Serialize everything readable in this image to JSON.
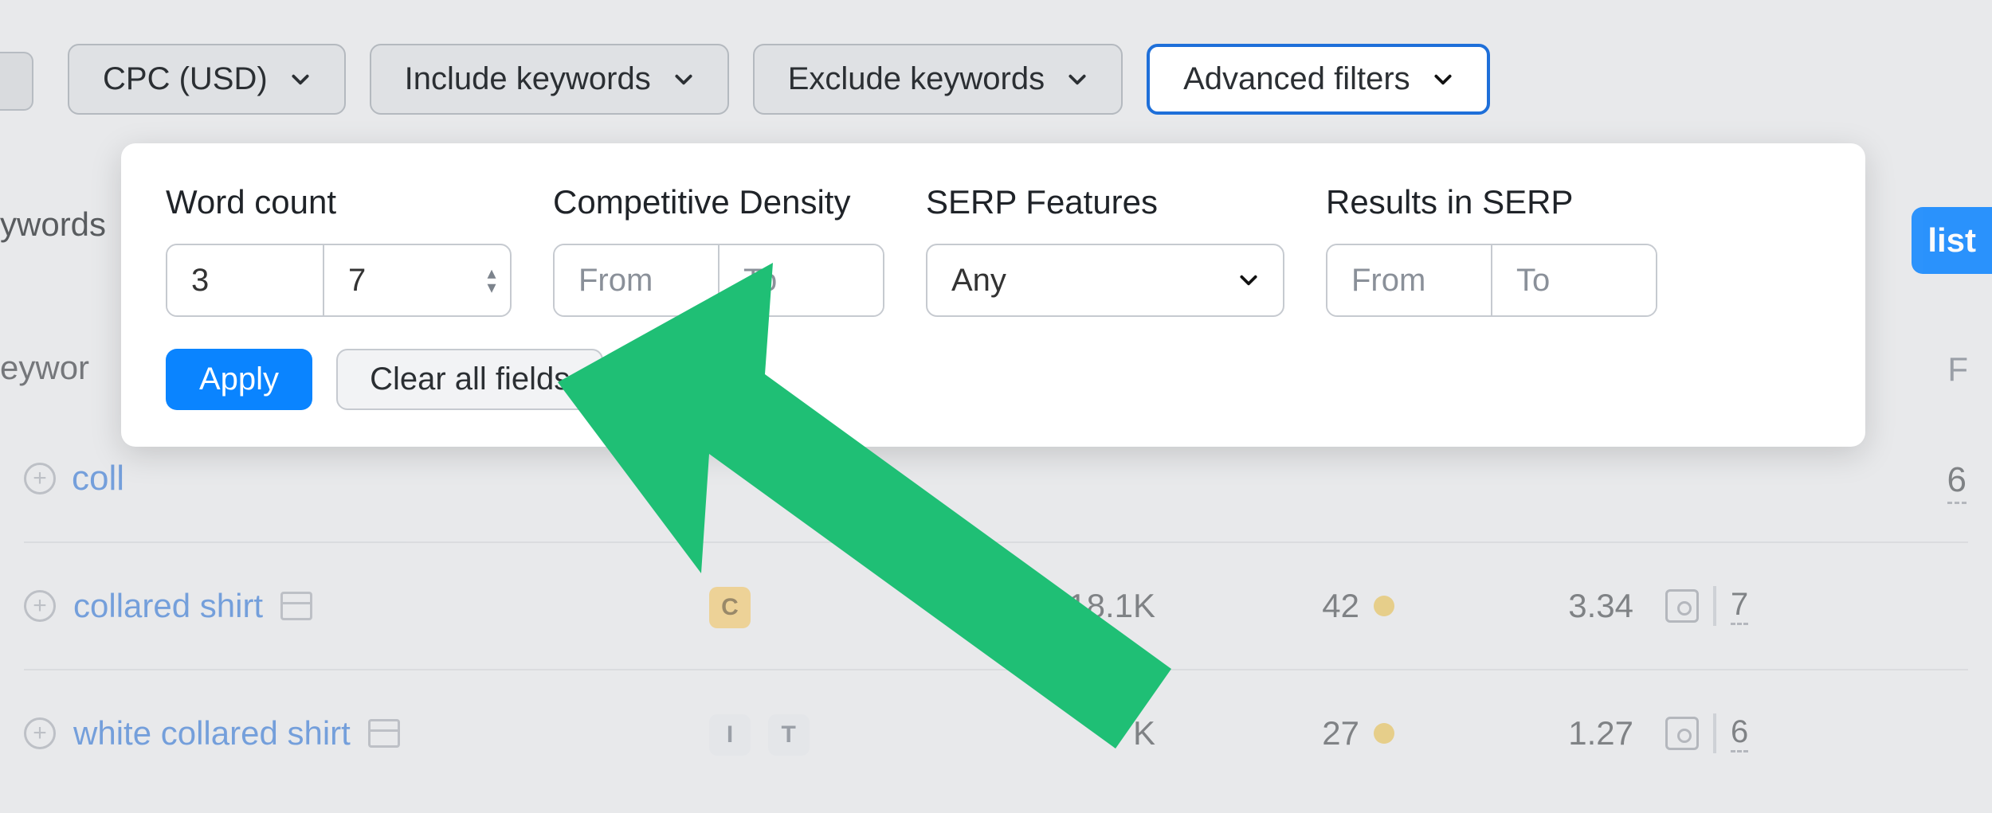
{
  "filters": {
    "cpc_label": "CPC (USD)",
    "include_label": "Include keywords",
    "exclude_label": "Exclude keywords",
    "advanced_label": "Advanced filters"
  },
  "fragments": {
    "left1": "ywords",
    "left2": "eywor",
    "right_col": "F",
    "coll": "coll",
    "six": "6",
    "list_chip": "list"
  },
  "popover": {
    "word_count": {
      "label": "Word count",
      "from": "3",
      "to": "7"
    },
    "competitive_density": {
      "label": "Competitive Density",
      "from_ph": "From",
      "to_ph": "To"
    },
    "serp_features": {
      "label": "SERP Features",
      "value": "Any"
    },
    "results_serp": {
      "label": "Results in SERP",
      "from_ph": "From",
      "to_ph": "To"
    },
    "apply": "Apply",
    "clear": "Clear all fields"
  },
  "rows": [
    {
      "keyword": "collared shirt",
      "intent_badges": [
        "C"
      ],
      "volume": "18.1K",
      "kd": "42",
      "cpc": "3.34",
      "sf": "7"
    },
    {
      "keyword": "white collared shirt",
      "intent_badges": [
        "I",
        "T"
      ],
      "volume": "K",
      "kd": "27",
      "cpc": "1.27",
      "sf": "6"
    }
  ]
}
